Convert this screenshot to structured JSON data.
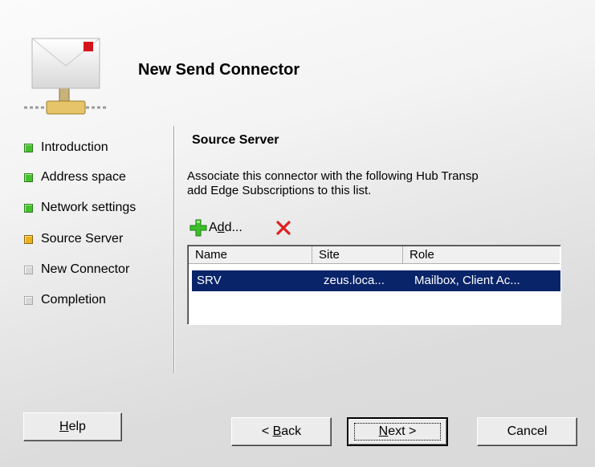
{
  "title": "New Send Connector",
  "steps": [
    {
      "label": "Introduction",
      "state": "done"
    },
    {
      "label": "Address space",
      "state": "done"
    },
    {
      "label": "Network settings",
      "state": "done"
    },
    {
      "label": "Source Server",
      "state": "current"
    },
    {
      "label": "New Connector",
      "state": "pending"
    },
    {
      "label": "Completion",
      "state": "pending"
    }
  ],
  "section_title": "Source Server",
  "description_line1": "Associate this connector with the following Hub Transp",
  "description_line2": "add Edge Subscriptions to this list.",
  "toolbar": {
    "add_prefix": "A",
    "add_mnemonic": "d",
    "add_suffix": "d...",
    "add_icon": "plus-icon",
    "remove_icon": "red-x-icon"
  },
  "table": {
    "columns": [
      "Name",
      "Site",
      "Role"
    ],
    "rows": [
      {
        "name": "SRV",
        "site": "zeus.loca...",
        "role": "Mailbox, Client Ac..."
      }
    ]
  },
  "buttons": {
    "help_mnemonic": "H",
    "help_rest": "elp",
    "back_prefix": "< ",
    "back_mnemonic": "B",
    "back_rest": "ack",
    "next_mnemonic": "N",
    "next_rest": "ext >",
    "cancel": "Cancel"
  },
  "colors": {
    "selection": "#0a246a",
    "step_done": "#46c12e",
    "step_current": "#e8b21c",
    "step_pending": "#d8d8d8",
    "remove_icon": "#e02020",
    "add_icon": "#3cbf2a"
  }
}
